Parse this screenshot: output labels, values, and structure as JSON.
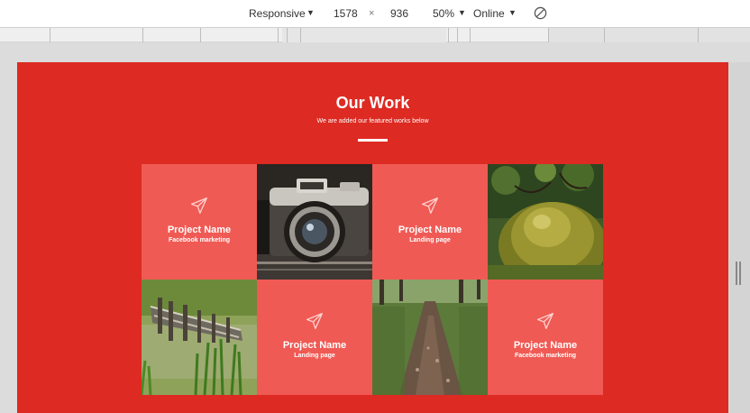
{
  "toolbar": {
    "device": "Responsive",
    "width": "1578",
    "times": "×",
    "height": "936",
    "zoom": "50%",
    "network": "Online",
    "caret": "▼",
    "throttle_icon": "no-throttle-icon"
  },
  "section": {
    "title": "Our Work",
    "subtitle": "We are added our featured works below"
  },
  "colors": {
    "background": "#dd2a22",
    "card": "#f05a54"
  },
  "projects": [
    {
      "name": "Project Name",
      "category": "Facebook marketing"
    },
    {
      "name": "Project Name",
      "category": "Landing page"
    },
    {
      "name": "Project Name",
      "category": "Landing page"
    },
    {
      "name": "Project Name",
      "category": "Facebook marketing"
    }
  ],
  "photos": [
    "camera",
    "mossy-rock",
    "wooden-pier",
    "forest-path"
  ]
}
